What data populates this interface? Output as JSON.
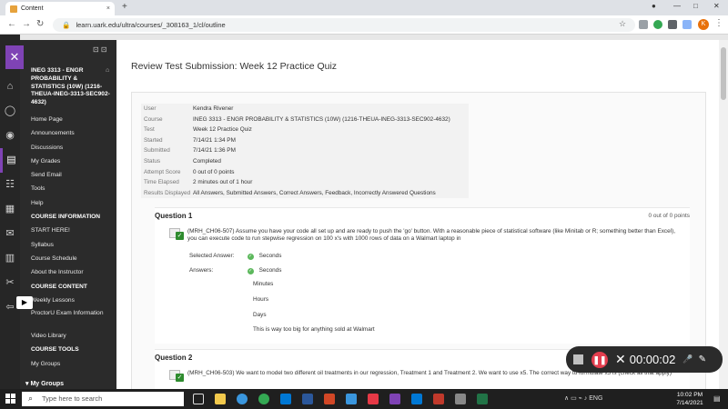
{
  "browser": {
    "tab_title": "Content",
    "tab_close": "×",
    "new_tab": "+",
    "url": "learn.uark.edu/ultra/courses/_308163_1/cl/outline",
    "lock": "🔒",
    "back": "←",
    "forward": "→",
    "reload": "↻",
    "star": "☆",
    "avatar": "K",
    "menu": "⋮",
    "win_min": "—",
    "win_max": "□",
    "win_close": "✕"
  },
  "course": {
    "close_icon": "✕",
    "tools_icon": "⊡ ⊡",
    "home_icon": "⌂",
    "title": "INEG 3313 - ENGR PROBABILITY & STATISTICS (10W) (1216-THEUA-INEG-3313-SEC902-4632)",
    "menu_items": [
      {
        "label": "Home Page",
        "type": "item"
      },
      {
        "label": "Announcements",
        "type": "item"
      },
      {
        "label": "Discussions",
        "type": "item"
      },
      {
        "label": "My Grades",
        "type": "item"
      },
      {
        "label": "Send Email",
        "type": "item"
      },
      {
        "label": "Tools",
        "type": "item"
      },
      {
        "label": "Help",
        "type": "item"
      },
      {
        "label": "COURSE INFORMATION",
        "type": "head"
      },
      {
        "label": "START HERE!",
        "type": "item"
      },
      {
        "label": "Syllabus",
        "type": "item"
      },
      {
        "label": "Course Schedule",
        "type": "item"
      },
      {
        "label": "About the Instructor",
        "type": "item"
      },
      {
        "label": "COURSE CONTENT",
        "type": "head"
      },
      {
        "label": "Weekly Lessons",
        "type": "item"
      },
      {
        "label": "ProctorU Exam Information",
        "type": "two"
      },
      {
        "label": "Video Library",
        "type": "item"
      },
      {
        "label": "COURSE TOOLS",
        "type": "head"
      },
      {
        "label": "My Groups",
        "type": "item"
      }
    ],
    "my_groups_header": "▾ My Groups"
  },
  "page": {
    "title": "Review Test Submission: Week 12 Practice Quiz",
    "info": [
      {
        "label": "User",
        "value": "Kendra Rivener"
      },
      {
        "label": "Course",
        "value": "INEG 3313 - ENGR PROBABILITY & STATISTICS (10W) (1216-THEUA-INEG-3313-SEC902-4632)"
      },
      {
        "label": "Test",
        "value": "Week 12 Practice Quiz"
      },
      {
        "label": "Started",
        "value": "7/14/21 1:34 PM"
      },
      {
        "label": "Submitted",
        "value": "7/14/21 1:36 PM"
      },
      {
        "label": "Status",
        "value": "Completed"
      },
      {
        "label": "Attempt Score",
        "value": "0 out of 0 points"
      },
      {
        "label": "Time Elapsed",
        "value": "2 minutes out of 1 hour"
      },
      {
        "label": "Results Displayed",
        "value": "All Answers, Submitted Answers, Correct Answers, Feedback, Incorrectly Answered Questions"
      }
    ],
    "q1": {
      "title": "Question 1",
      "points": "0 out of 0 points",
      "text": "(MRH_CH06-507) Assume you have your code all set up and are ready to push the 'go' button. With a reasonable piece of statistical software (like Minitab or R; something better than Excel), you can execute code to run stepwise regression on 100 x's with 1000 rows of data on a Walmart laptop in",
      "selected_label": "Selected Answer:",
      "selected_value": "Seconds",
      "answers_label": "Answers:",
      "answers": [
        "Seconds",
        "Minutes",
        "Hours",
        "Days",
        "This is way too big for anything sold at Walmart"
      ]
    },
    "q2": {
      "title": "Question 2",
      "text": "(MRH_CH06-503) We want to model two different oil treatments in our regression, Treatment 1 and Treatment 2. We want to use x5. The correct way to formulate x5 is (check all that apply)"
    }
  },
  "recorder": {
    "time": "00:00:02",
    "pause_icon": "❚❚",
    "cancel_icon": "✕",
    "mic_icon": "🎤",
    "pen_icon": "✎"
  },
  "taskbar": {
    "search_placeholder": "Type here to search",
    "search_icon": "⌕",
    "tray": "∧ ▭ ⌁ ♪ ENG",
    "time": "10:02 PM",
    "date": "7/14/2021",
    "notif_icon": "▤"
  },
  "colors": {
    "accent_purple": "#7f43b5",
    "record_red": "#e33d4e",
    "check_green": "#5cb85c"
  }
}
